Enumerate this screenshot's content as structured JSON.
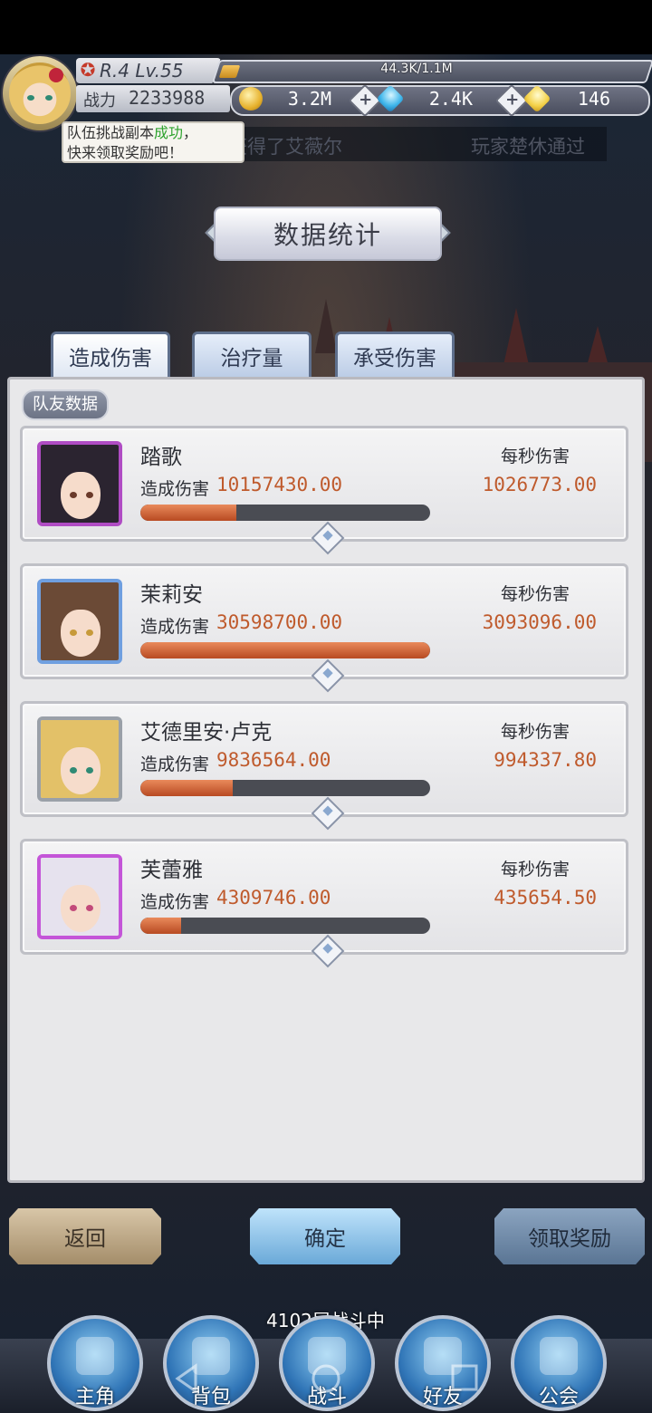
{
  "player": {
    "level_text": "R.4 Lv.55",
    "exp_text": "44.3K/1.1M",
    "exp_fraction": 0.04,
    "power_label": "战力",
    "power_value": "2233988"
  },
  "currencies": [
    {
      "icon": "gold-coin-icon",
      "value": "3.2M"
    },
    {
      "icon": "blue-gem-icon",
      "value": "2.4K"
    },
    {
      "icon": "yellow-crystal-icon",
      "value": "146"
    }
  ],
  "ticker": [
    "获得了艾薇尔",
    "玩家楚休通过"
  ],
  "tooltip": {
    "line1_prefix": "队伍挑战副本",
    "line1_highlight": "成功",
    "line1_suffix": "，",
    "line2": "快来领取奖励吧！"
  },
  "title": "数据统计",
  "tabs": [
    "造成伤害",
    "治疗量",
    "承受伤害"
  ],
  "active_tab": 0,
  "section_label": "队友数据",
  "labels": {
    "damage_dealt": "造成伤害",
    "dps": "每秒伤害"
  },
  "teammates": [
    {
      "name": "踏歌",
      "damage": "10157430.00",
      "dps": "1026773.00",
      "bar_fraction": 0.33,
      "frame_color": "#b04cc4",
      "hair_color": "#2b2430",
      "eye_color": "#6a3a2a"
    },
    {
      "name": "茉莉安",
      "damage": "30598700.00",
      "dps": "3093096.00",
      "bar_fraction": 1.0,
      "frame_color": "#6f9fe0",
      "hair_color": "#6b4a36",
      "eye_color": "#c79a3a"
    },
    {
      "name": "艾德里安·卢克",
      "damage": "9836564.00",
      "dps": "994337.80",
      "bar_fraction": 0.32,
      "frame_color": "#9aa0a8",
      "hair_color": "#e3c168",
      "eye_color": "#2f8a74"
    },
    {
      "name": "芙蕾雅",
      "damage": "4309746.00",
      "dps": "435654.50",
      "bar_fraction": 0.14,
      "frame_color": "#c455d8",
      "hair_color": "#e6e2ee",
      "eye_color": "#c24a7a"
    }
  ],
  "buttons": {
    "back": "返回",
    "confirm": "确定",
    "claim": "领取奖励"
  },
  "floor_status": "4102层战斗中",
  "nav": [
    "主角",
    "背包",
    "战斗",
    "好友",
    "公会"
  ]
}
